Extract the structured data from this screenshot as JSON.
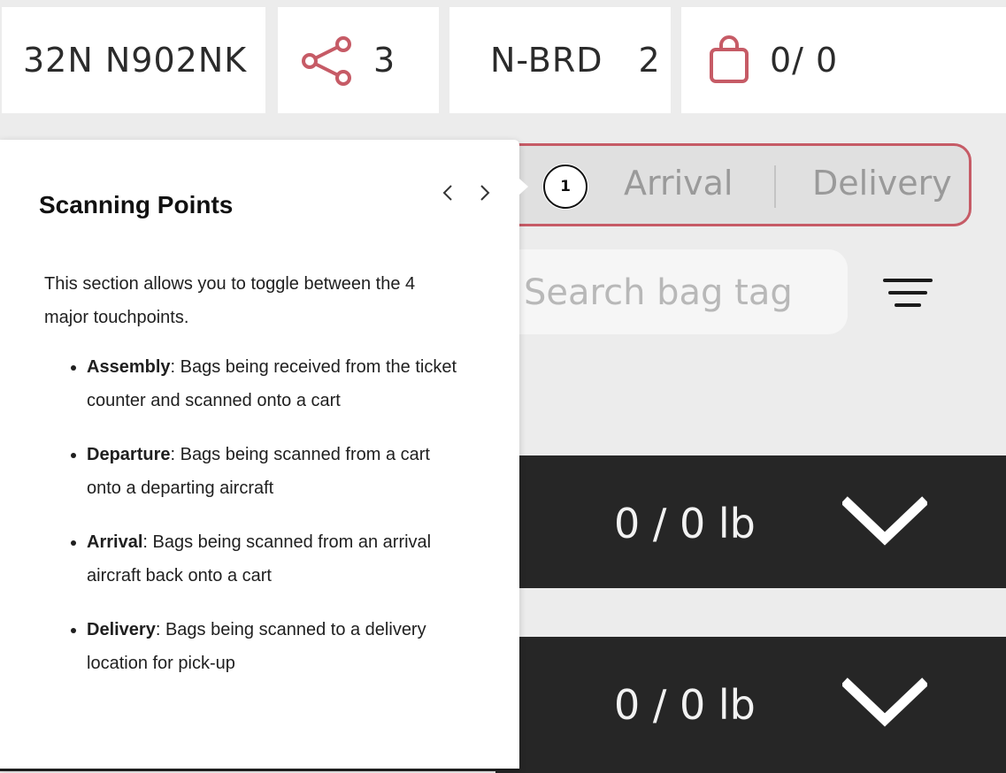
{
  "header": {
    "flight": "32N N902NK",
    "share_icon": "share-icon",
    "share_count": "3",
    "gate_code": "N-BRD",
    "gate_count": "2",
    "bag_icon": "shopping-bag-icon",
    "bag_count": "0/ 0"
  },
  "segment": {
    "step_number": "1",
    "tabs": [
      {
        "label": "Arrival"
      },
      {
        "label": "Delivery"
      }
    ],
    "accent_color": "#c65b66"
  },
  "search": {
    "placeholder": "Search bag tag",
    "filter_icon": "filter-icon"
  },
  "rows": [
    {
      "weight": "0 / 0 lb",
      "icon": "chevron-down-icon"
    },
    {
      "weight": "0 / 0 lb",
      "icon": "chevron-down-icon"
    }
  ],
  "tour": {
    "title": "Scanning Points",
    "prev_icon": "chevron-left-icon",
    "next_icon": "chevron-right-icon",
    "intro": "This section allows you to toggle between the 4 major touchpoints.",
    "items": [
      {
        "term": "Assembly",
        "desc": ": Bags being received from the ticket counter and scanned onto a cart"
      },
      {
        "term": "Departure",
        "desc": ": Bags being scanned from a cart onto a departing aircraft"
      },
      {
        "term": "Arrival",
        "desc": ": Bags being scanned from an arrival aircraft back onto a cart"
      },
      {
        "term": "Delivery",
        "desc": ": Bags being scanned to a delivery location for pick-up"
      }
    ]
  }
}
